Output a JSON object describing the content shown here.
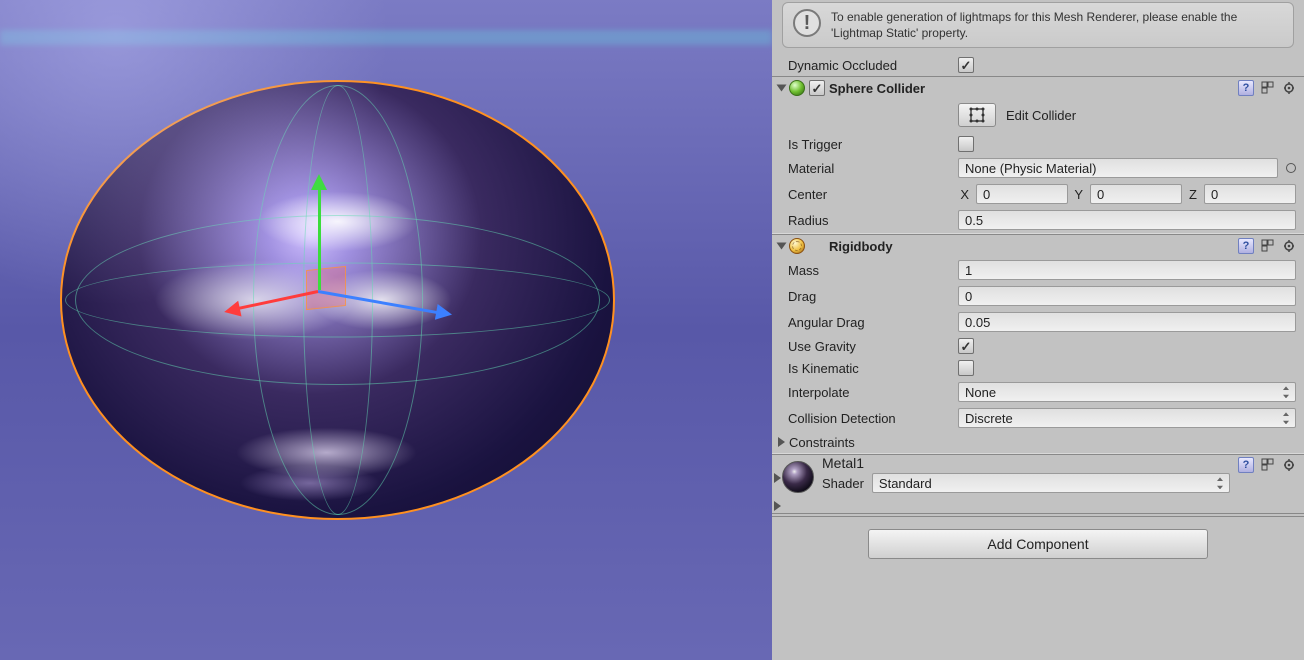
{
  "info": {
    "text": "To enable generation of lightmaps for this Mesh Renderer, please enable the 'Lightmap Static' property."
  },
  "renderer": {
    "dynamic_occluded_label": "Dynamic Occluded",
    "dynamic_occluded_checked": "✓"
  },
  "sphere_collider": {
    "title": "Sphere Collider",
    "enabled": "✓",
    "edit_collider_label": "Edit Collider",
    "is_trigger_label": "Is Trigger",
    "material_label": "Material",
    "material_value": "None (Physic Material)",
    "center_label": "Center",
    "center": {
      "x": "0",
      "y": "0",
      "z": "0"
    },
    "radius_label": "Radius",
    "radius": "0.5"
  },
  "rigidbody": {
    "title": "Rigidbody",
    "mass_label": "Mass",
    "mass": "1",
    "drag_label": "Drag",
    "drag": "0",
    "angular_drag_label": "Angular Drag",
    "angular_drag": "0.05",
    "use_gravity_label": "Use Gravity",
    "use_gravity_checked": "✓",
    "is_kinematic_label": "Is Kinematic",
    "interpolate_label": "Interpolate",
    "interpolate": "None",
    "collision_detection_label": "Collision Detection",
    "collision_detection": "Discrete",
    "constraints_label": "Constraints"
  },
  "material": {
    "name": "Metal1",
    "shader_label": "Shader",
    "shader": "Standard"
  },
  "add_component_label": "Add Component",
  "axis_labels": {
    "x": "X",
    "y": "Y",
    "z": "Z"
  }
}
